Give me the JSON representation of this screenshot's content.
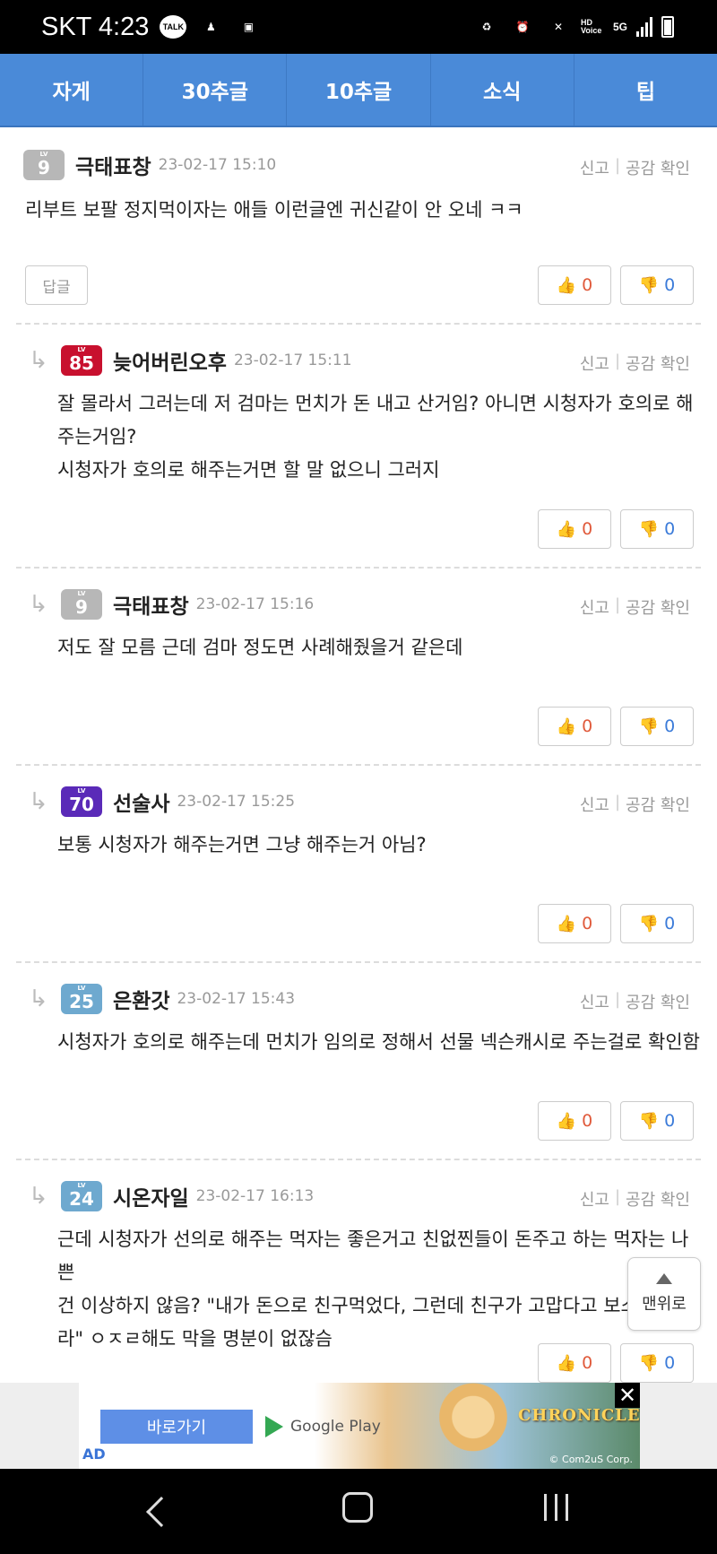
{
  "status_bar": {
    "carrier_time": "SKT 4:23",
    "talk": "TALK",
    "hd_voice": "HD Voice",
    "network": "5G"
  },
  "tabs": [
    "자게",
    "30추글",
    "10추글",
    "소식",
    "팁"
  ],
  "actions": {
    "report": "신고",
    "separator": "|",
    "likes_check": "공감 확인",
    "reply": "답글"
  },
  "comments": [
    {
      "level": "9",
      "nick": "극태표창",
      "date": "23-02-17 15:10",
      "text": [
        "리부트 보팔 정지먹이자는 애들 이런글엔 귀신같이 안 오네 ㅋㅋ"
      ],
      "likes": "0",
      "dislikes": "0",
      "is_reply": false
    },
    {
      "level": "85",
      "nick": "늦어버린오후",
      "date": "23-02-17 15:11",
      "text": [
        "잘 몰라서 그러는데 저 검마는 먼치가 돈 내고 산거임? 아니면 시청자가 호의로 해",
        "주는거임?",
        "시청자가 호의로 해주는거면 할 말 없으니 그러지"
      ],
      "likes": "0",
      "dislikes": "0",
      "is_reply": true
    },
    {
      "level": "9",
      "nick": "극태표창",
      "date": "23-02-17 15:16",
      "text": [
        "저도 잘 모름 근데 검마 정도면 사례해줬을거 같은데"
      ],
      "likes": "0",
      "dislikes": "0",
      "is_reply": true
    },
    {
      "level": "70",
      "nick": "선술사",
      "date": "23-02-17 15:25",
      "text": [
        "보통 시청자가 해주는거면 그냥 해주는거 아님?"
      ],
      "likes": "0",
      "dislikes": "0",
      "is_reply": true
    },
    {
      "level": "25",
      "nick": "은환갓",
      "date": "23-02-17 15:43",
      "text": [
        "시청자가 호의로 해주는데 먼치가 임의로 정해서 선물 넥슨캐시로 주는걸로 확인함"
      ],
      "likes": "0",
      "dislikes": "0",
      "is_reply": true
    },
    {
      "level": "24",
      "nick": "시온자일",
      "date": "23-02-17 16:13",
      "text": [
        "근데 시청자가 선의로 해주는 먹자는 좋은거고 친없찐들이 돈주고 하는 먹자는 나쁜",
        "건 이상하지 않음? \"내가 돈으로 친구먹었다, 그런데 친구가 고맙다고 보스",
        "라\" ㅇㅈㄹ해도 막을 명분이 없잖슴"
      ],
      "likes": "0",
      "dislikes": "0",
      "is_reply": true
    }
  ],
  "to_top_label": "맨위로",
  "ad": {
    "button": "바로가기",
    "store": "Google Play",
    "tag": "AD",
    "title": "CHRONICLES",
    "corp": "© Com2uS Corp.",
    "close": "✕"
  },
  "colors": {
    "tab_bg": "#4a8ad8",
    "like": "#e05a3b",
    "dislike": "#3b7bd9",
    "level_9": "#b7b7b7",
    "level_85": "#c8102e",
    "level_70": "#5a2ab8",
    "level_25": "#6ea9cf",
    "level_24": "#6ea9cf"
  }
}
